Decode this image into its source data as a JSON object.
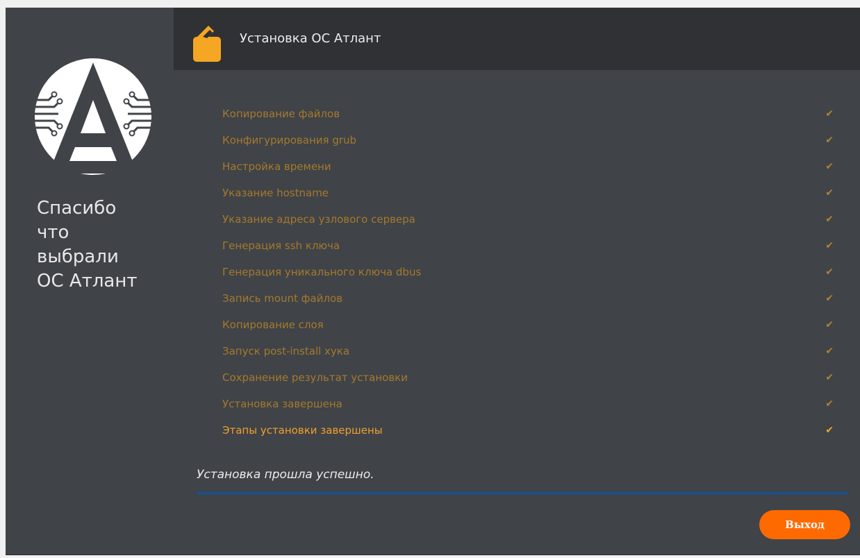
{
  "window": {
    "title": "Установка ОС Атлант"
  },
  "sidebar": {
    "thanks_text": "Спасибо\nчто\nвыбрали\nОС Атлант",
    "logo_icon": "atlant-logo-icon"
  },
  "header": {
    "icon": "installer-box-icon",
    "title": "Установка ОС Атлант"
  },
  "steps": [
    {
      "label": "Копирование файлов",
      "done": true
    },
    {
      "label": "Конфигурирования grub",
      "done": true
    },
    {
      "label": "Настройка времени",
      "done": true
    },
    {
      "label": "Указание hostname",
      "done": true
    },
    {
      "label": "Указание адреса узлового сервера",
      "done": true
    },
    {
      "label": "Генерация ssh ключа",
      "done": true
    },
    {
      "label": "Генерация уникального ключа dbus",
      "done": true
    },
    {
      "label": "Запись mount файлов",
      "done": true
    },
    {
      "label": "Копирование слоя",
      "done": true
    },
    {
      "label": "Запуск post-install хука",
      "done": true
    },
    {
      "label": "Сохранение результат установки",
      "done": true
    },
    {
      "label": "Установка завершена",
      "done": true
    },
    {
      "label": "Этапы установки завершены",
      "done": true,
      "current": true
    }
  ],
  "check_glyph": "✔",
  "status": {
    "message": "Установка прошла успешно.",
    "progress_percent": 100
  },
  "buttons": {
    "exit_label": "Выход"
  },
  "colors": {
    "accent": "#ff6a00",
    "step_text": "#a57a2c",
    "step_current": "#f0a030",
    "progress": "#234e7e"
  }
}
